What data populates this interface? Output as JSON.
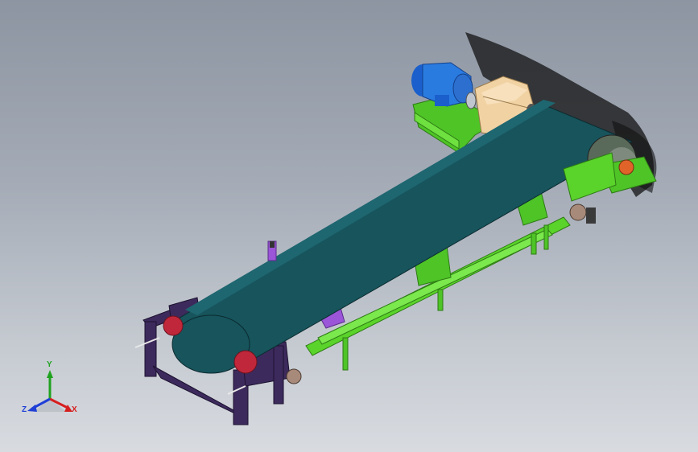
{
  "scene": {
    "model": "belt-conveyor-assembly",
    "colors": {
      "background_top": "#8d95a2",
      "background_bottom": "#d8dbe0",
      "belt": "#16525a",
      "frame": "#5ad32a",
      "end_frame": "#3d2a5c",
      "motor": "#2a7be0",
      "gearbox": "#f0cfa0",
      "pulley_flange": "#c0273a",
      "bearing": "#e0642a",
      "take_up": "#7a4ac8",
      "shadow": "#1a1a1a"
    }
  },
  "triad": {
    "x_label": "X",
    "y_label": "Y",
    "z_label": "Z",
    "x_color": "#d61f1f",
    "y_color": "#1fa21f",
    "z_color": "#1f3fd6"
  }
}
